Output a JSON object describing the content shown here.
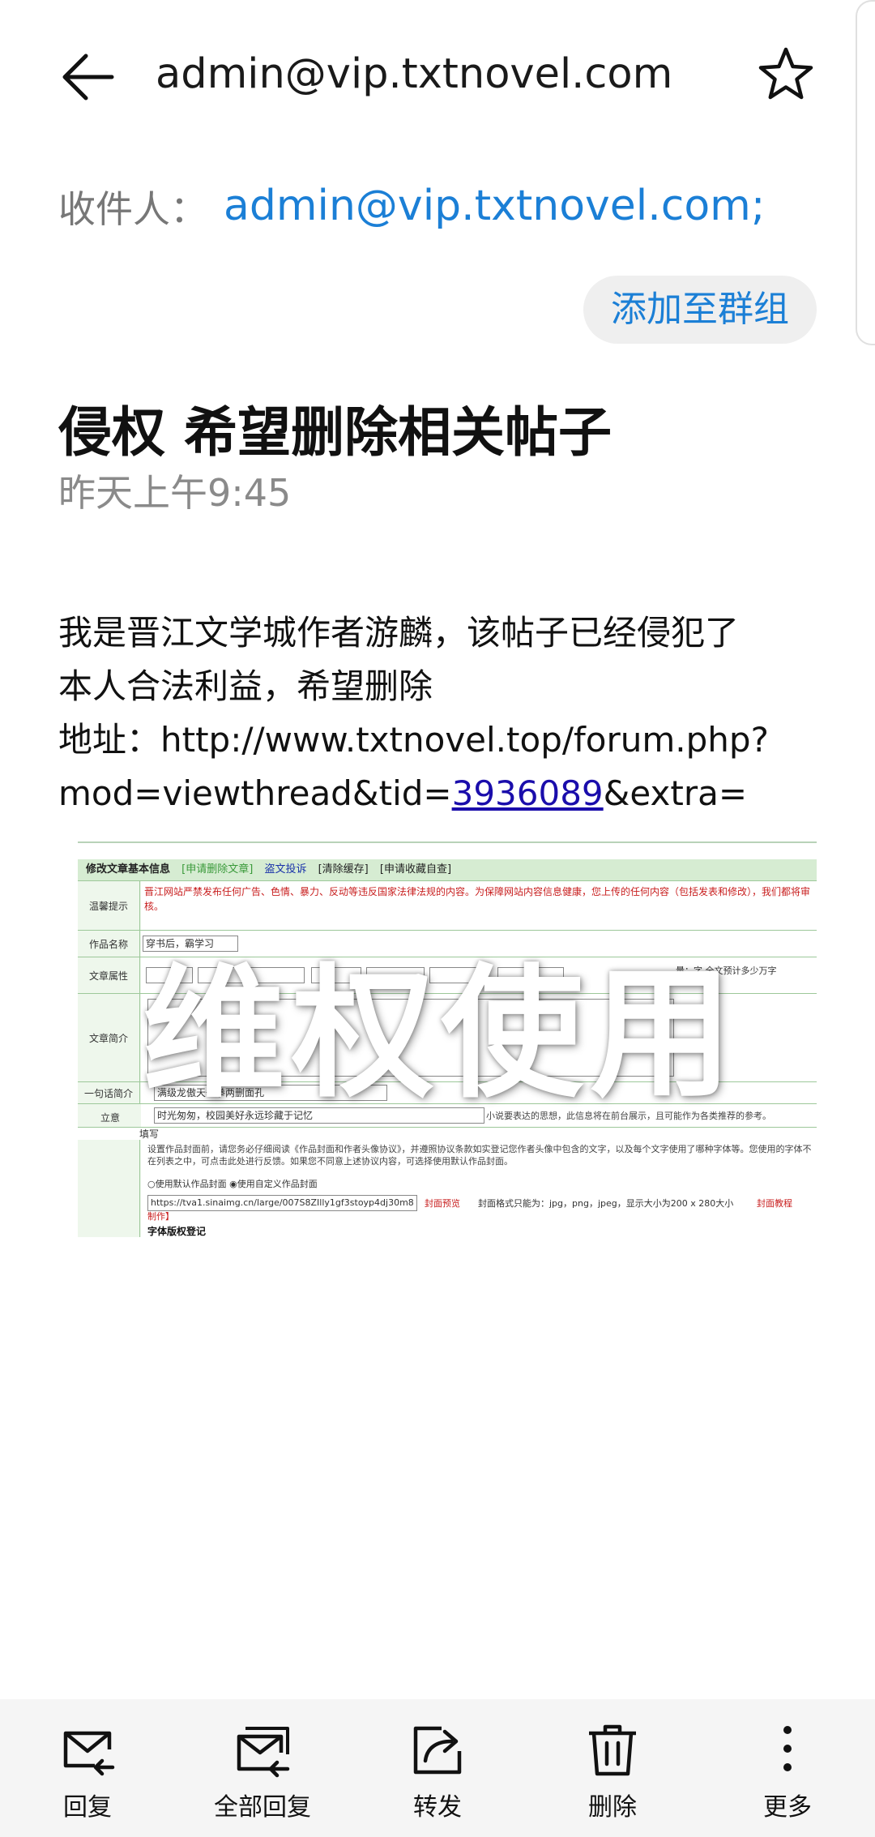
{
  "header": {
    "title": "admin@vip.txtnovel.com",
    "back_icon": "back-arrow-icon",
    "star_icon": "star-icon"
  },
  "recipient": {
    "label": "收件人：",
    "value": "admin@vip.txtnovel.com;"
  },
  "add_group_button": "添加至群组",
  "message": {
    "subject": "侵权 希望删除相关帖子",
    "time": "昨天上午9:45",
    "body_line1": "我是晋江文学城作者游麟，该帖子已经侵犯了",
    "body_line2": "本人合法利益，希望删除",
    "body_line3": "地址：http://www.txtnovel.top/forum.php?",
    "body_line4_prefix": "mod=viewthread&tid=",
    "body_line4_link": "3936089",
    "body_line4_suffix": "&extra="
  },
  "attachment_image": {
    "watermark": "维权使用",
    "header_title": "修改文章基本信息",
    "header_links": [
      "[申请删除文章]",
      "盗文投诉",
      "[清除缓存]",
      "[申请收藏自查]"
    ],
    "rows": [
      {
        "label": "温馨提示",
        "text": "晋江网站严禁发布任何广告、色情、暴力、反动等违反国家法律法规的内容。为保障网站内容信息健康，您上传的任何内容（包括发表和修改），我们都将审核。"
      },
      {
        "label": "作品名称",
        "text": "穿书后，霸学习"
      },
      {
        "label": "文章属性",
        "text": "量：字  全文预计多少万字"
      },
      {
        "label": "文章简介",
        "text": ""
      },
      {
        "label": "一句话简介",
        "text": "满级龙傲天一拳两删面孔"
      },
      {
        "label": "立意",
        "text": "时光匆匆，校园美好永远珍藏于记忆"
      },
      {
        "label": "",
        "text": "小说要表达的思想，此信息将在前台展示，且可能作为各类推荐的参考。"
      }
    ],
    "cover_note": "设置作品封面前，请您务必仔细阅读《作品封面和作者头像协议》，并遵照协议条款如实登记您作者头像中包含的文字，以及每个文字使用了哪种字体等。您使用的字体不在列表之中，可点击此处进行反馈。如果您不同意上述协议内容，可选择使用默认作品封面。",
    "radio_default": "使用默认作品封面",
    "radio_custom": "使用自定义作品封面",
    "cover_url": "https://tva1.sinaimg.cn/large/007S8ZIlly1gf3stoyp4dj30m8",
    "cover_preview": "封面预览",
    "cover_format": "封面格式只能为：jpg，png，jpeg，显示大小为200 x 280大小",
    "cover_tutorial": "封面教程",
    "cover_make": "制作】",
    "font_section": "字体版权登记",
    "fill_label": "填写"
  },
  "toolbar": {
    "reply": "回复",
    "reply_all": "全部回复",
    "forward": "转发",
    "delete": "删除",
    "more": "更多"
  },
  "colors": {
    "link_blue": "#1b7fd6",
    "hyperlink": "#1a0dab",
    "toolbar_bg": "#f5f5f5",
    "form_green": "#d6ecd2"
  }
}
